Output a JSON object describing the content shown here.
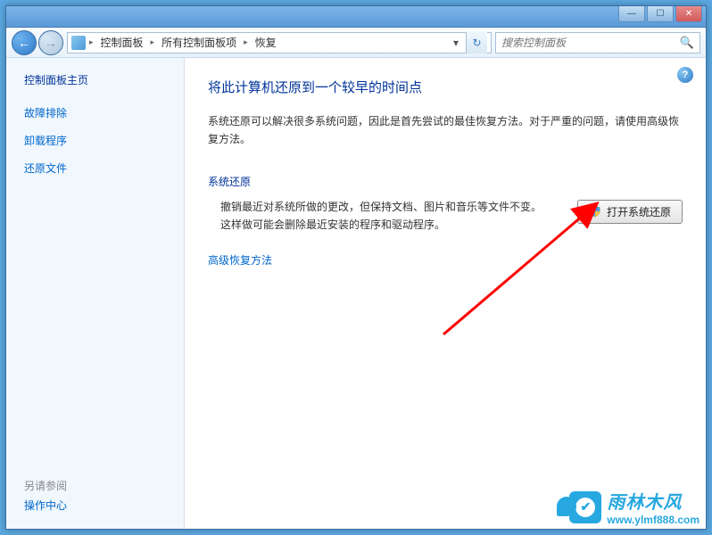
{
  "window": {
    "controls": {
      "min": "—",
      "max": "☐",
      "close": "✕"
    }
  },
  "nav": {
    "back_symbol": "←",
    "forward_symbol": "→",
    "refresh_symbol": "↻",
    "dropdown_symbol": "▾",
    "separator": "▸"
  },
  "breadcrumbs": [
    "控制面板",
    "所有控制面板项",
    "恢复"
  ],
  "search": {
    "placeholder": "搜索控制面板",
    "icon": "🔍"
  },
  "sidebar": {
    "title": "控制面板主页",
    "links": [
      "故障排除",
      "卸载程序",
      "还原文件"
    ],
    "see_also_label": "另请参阅",
    "see_also_link": "操作中心"
  },
  "main": {
    "help": "?",
    "title": "将此计算机还原到一个较早的时间点",
    "desc": "系统还原可以解决很多系统问题，因此是首先尝试的最佳恢复方法。对于严重的问题，请使用高级恢复方法。",
    "section_title": "系统还原",
    "section_desc": "撤销最近对系统所做的更改，但保持文档、图片和音乐等文件不变。这样做可能会删除最近安装的程序和驱动程序。",
    "restore_button": "打开系统还原",
    "advanced_link": "高级恢复方法"
  },
  "watermark": {
    "cn": "雨林木风",
    "url": "www.ylmf888.com",
    "logo_glyph": "✔"
  }
}
